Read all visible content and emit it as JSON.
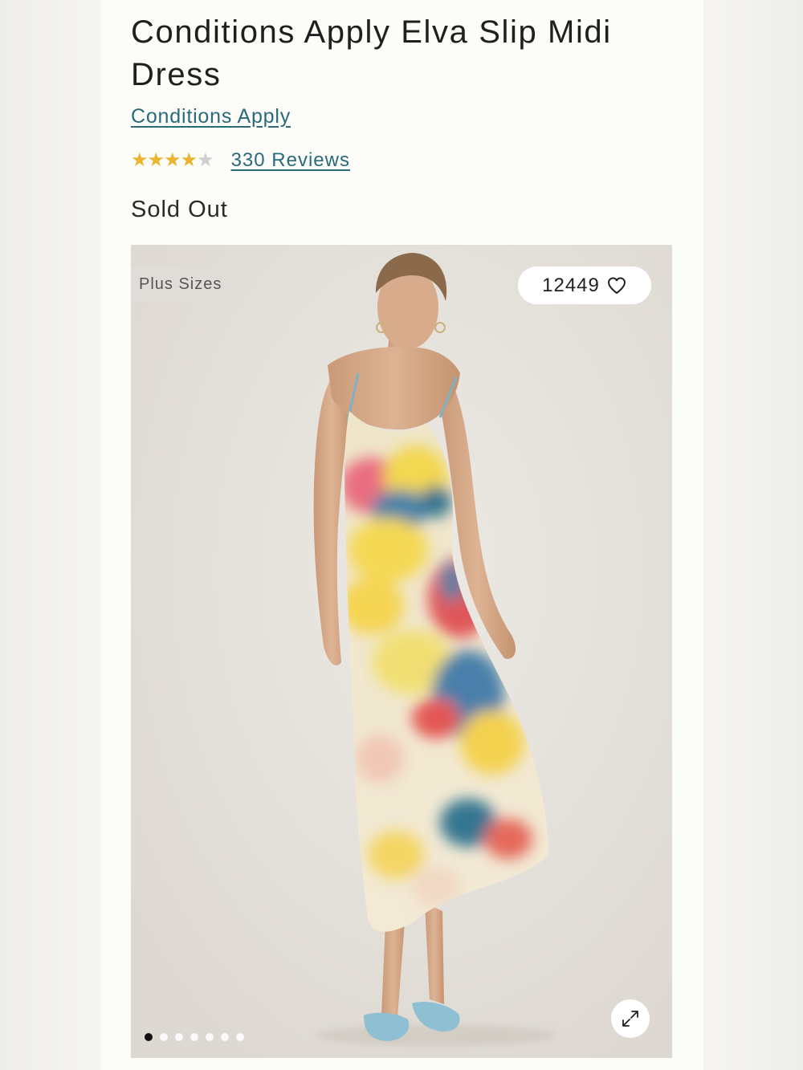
{
  "product": {
    "title": "Conditions Apply Elva Slip Midi Dress",
    "brand_link": "Conditions Apply",
    "rating": 4,
    "rating_max": 5,
    "reviews_link": "330 Reviews",
    "availability": "Sold Out"
  },
  "gallery": {
    "badge": "Plus Sizes",
    "likes": "12449",
    "like_icon": "heart-icon",
    "expand_icon": "expand-icon",
    "image_count": 7,
    "current_index": 0
  },
  "colors": {
    "link": "#2a6a7b",
    "star": "#e9b52e"
  }
}
